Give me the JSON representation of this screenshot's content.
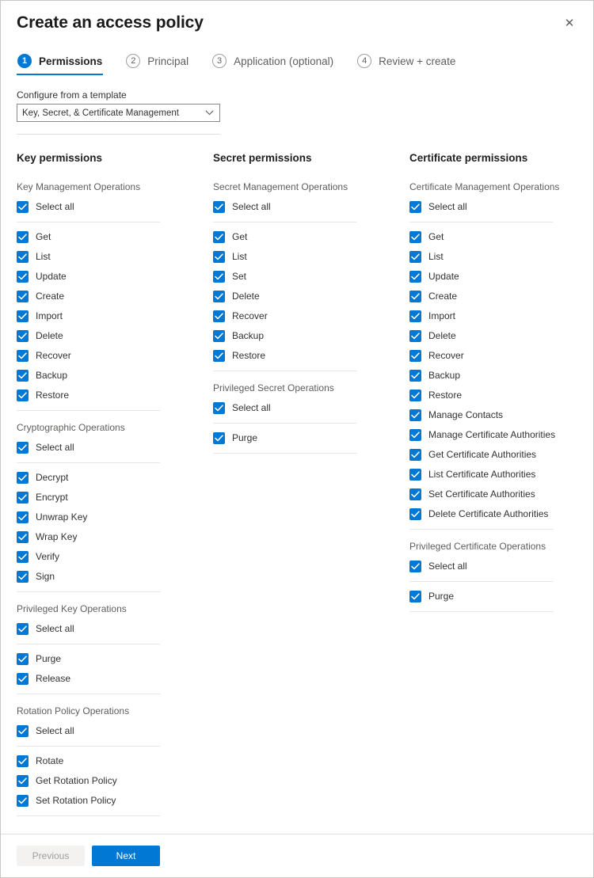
{
  "window": {
    "title": "Create an access policy",
    "close_icon": "close-icon",
    "close_glyph": "✕"
  },
  "steps": [
    {
      "number": "1",
      "label": "Permissions",
      "active": true
    },
    {
      "number": "2",
      "label": "Principal",
      "active": false
    },
    {
      "number": "3",
      "label": "Application (optional)",
      "active": false
    },
    {
      "number": "4",
      "label": "Review + create",
      "active": false
    }
  ],
  "template": {
    "label": "Configure from a template",
    "value": "Key, Secret, & Certificate Management",
    "chevron_icon": "chevron-down-icon"
  },
  "columns": [
    {
      "title": "Key permissions",
      "groups": [
        {
          "title": "Key Management Operations",
          "select_all": "Select all",
          "items": [
            "Get",
            "List",
            "Update",
            "Create",
            "Import",
            "Delete",
            "Recover",
            "Backup",
            "Restore"
          ]
        },
        {
          "title": "Cryptographic Operations",
          "select_all": "Select all",
          "items": [
            "Decrypt",
            "Encrypt",
            "Unwrap Key",
            "Wrap Key",
            "Verify",
            "Sign"
          ]
        },
        {
          "title": "Privileged Key Operations",
          "select_all": "Select all",
          "items": [
            "Purge",
            "Release"
          ]
        },
        {
          "title": "Rotation Policy Operations",
          "select_all": "Select all",
          "items": [
            "Rotate",
            "Get Rotation Policy",
            "Set Rotation Policy"
          ]
        }
      ]
    },
    {
      "title": "Secret permissions",
      "groups": [
        {
          "title": "Secret Management Operations",
          "select_all": "Select all",
          "items": [
            "Get",
            "List",
            "Set",
            "Delete",
            "Recover",
            "Backup",
            "Restore"
          ]
        },
        {
          "title": "Privileged Secret Operations",
          "select_all": "Select all",
          "items": [
            "Purge"
          ]
        }
      ]
    },
    {
      "title": "Certificate permissions",
      "groups": [
        {
          "title": "Certificate Management Operations",
          "select_all": "Select all",
          "items": [
            "Get",
            "List",
            "Update",
            "Create",
            "Import",
            "Delete",
            "Recover",
            "Backup",
            "Restore",
            "Manage Contacts",
            "Manage Certificate Authorities",
            "Get Certificate Authorities",
            "List Certificate Authorities",
            "Set Certificate Authorities",
            "Delete Certificate Authorities"
          ]
        },
        {
          "title": "Privileged Certificate Operations",
          "select_all": "Select all",
          "items": [
            "Purge"
          ]
        }
      ]
    }
  ],
  "footer": {
    "previous_label": "Previous",
    "next_label": "Next"
  },
  "colors": {
    "accent": "#0078d4",
    "checkbox_fill": "#0078d4",
    "text": "#323130",
    "muted_text": "#605e5c",
    "divider": "#e9e7e6"
  }
}
